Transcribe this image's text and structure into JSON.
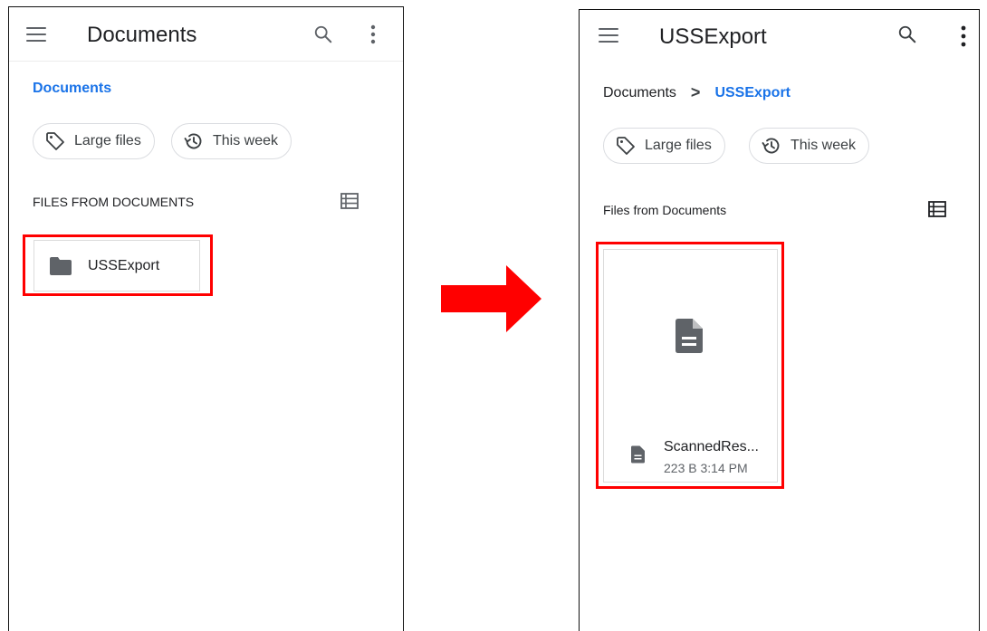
{
  "left": {
    "title": "Documents",
    "breadcrumb": [
      "Documents"
    ],
    "chips": [
      {
        "label": "Large files",
        "icon": "tag-icon"
      },
      {
        "label": "This week",
        "icon": "history-icon"
      }
    ],
    "section_label": "FILES FROM DOCUMENTS",
    "folders": [
      {
        "name": "USSExport",
        "icon": "folder-icon"
      }
    ]
  },
  "right": {
    "title": "USSExport",
    "breadcrumb": [
      "Documents",
      "USSExport"
    ],
    "breadcrumb_separator": ">",
    "chips": [
      {
        "label": "Large files",
        "icon": "tag-icon"
      },
      {
        "label": "This week",
        "icon": "history-icon"
      }
    ],
    "section_label": "Files from Documents",
    "files": [
      {
        "name": "ScannedRes...",
        "size": "223 B",
        "time": "3:14 PM",
        "icon": "document-icon"
      }
    ]
  },
  "colors": {
    "accent": "#1a73e8",
    "highlight": "#ff0000",
    "icon_gray": "#5f6368"
  }
}
